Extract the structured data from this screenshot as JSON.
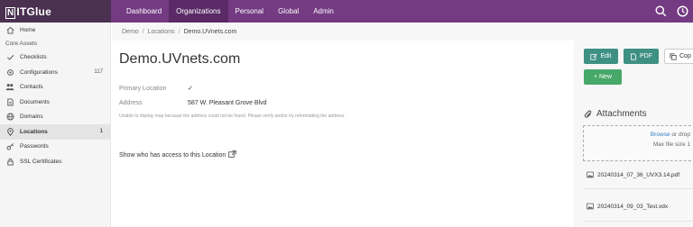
{
  "app": {
    "brand": "ITGlue"
  },
  "topnav": {
    "items": [
      {
        "label": "Dashboard"
      },
      {
        "label": "Organizations"
      },
      {
        "label": "Personal"
      },
      {
        "label": "Global"
      },
      {
        "label": "Admin"
      }
    ],
    "active_index": 1,
    "icons": [
      "search-icon",
      "clock-icon"
    ]
  },
  "sidebar": {
    "home": "Home",
    "section_label": "Core Assets",
    "items": [
      {
        "label": "Checklists",
        "count": "",
        "icon": "check-icon"
      },
      {
        "label": "Configurations",
        "count": "117",
        "icon": "gear-icon"
      },
      {
        "label": "Contacts",
        "count": "",
        "icon": "contacts-icon"
      },
      {
        "label": "Documents",
        "count": "",
        "icon": "document-icon"
      },
      {
        "label": "Domains",
        "count": "",
        "icon": "globe-icon"
      },
      {
        "label": "Locations",
        "count": "1",
        "icon": "location-pin-icon"
      },
      {
        "label": "Passwords",
        "count": "",
        "icon": "key-icon"
      },
      {
        "label": "SSL Certificates",
        "count": "",
        "icon": "lock-icon"
      }
    ],
    "active_label": "Locations"
  },
  "breadcrumb": {
    "org": "Demo",
    "section": "Locations",
    "current": "Demo.UVnets.com"
  },
  "page": {
    "title": "Demo.UVnets.com",
    "primary_location_label": "Primary Location",
    "primary_location_value": "✓",
    "address_label": "Address",
    "address_value": "587 W. Pleasant Grove Blvd",
    "map_error": "Unable to display map because the address could not be found. Please verify and/or try reformatting the address.",
    "access_link": "Show who has access to this Location"
  },
  "actions": {
    "edit": "Edit",
    "pdf": "PDF",
    "copy": "Cop",
    "new": "+ New"
  },
  "attachments": {
    "title": "Attachments",
    "browse": "Browse",
    "or_drop": "or drop",
    "max_size": "Max file size 1",
    "files": [
      "20240314_07_36_UVX3.14.pdf",
      "20240314_09_03_Test.vdx"
    ]
  },
  "colors": {
    "topbar": "#743a82",
    "brand_bg": "#4a3150",
    "edit_btn": "#3e9083",
    "new_btn": "#48a869",
    "link": "#2a7dc6"
  }
}
